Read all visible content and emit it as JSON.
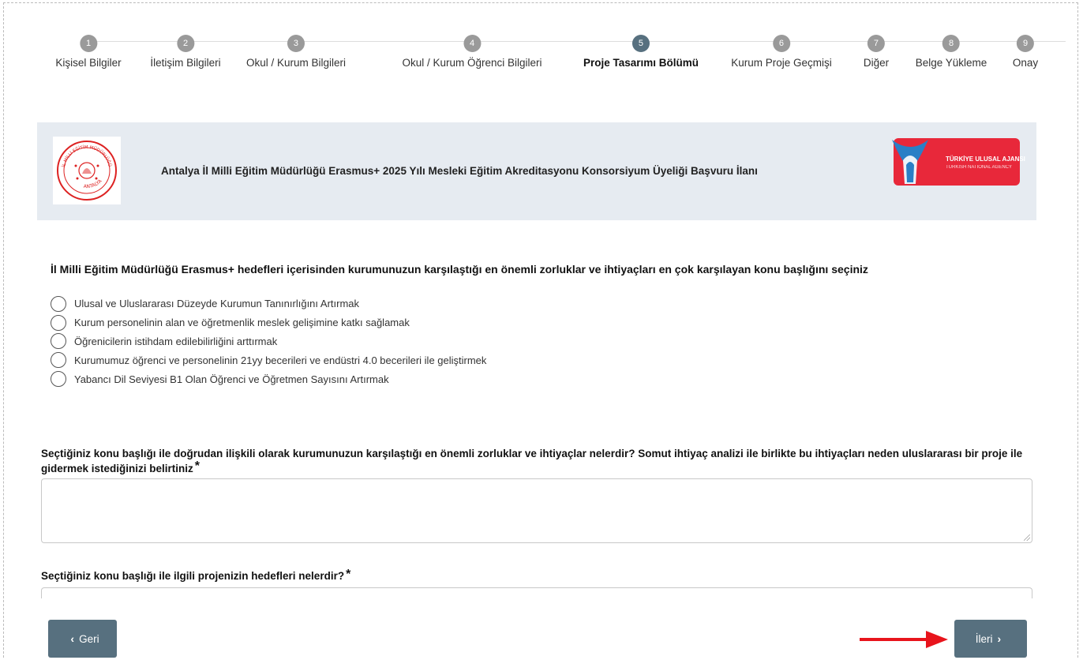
{
  "steps": [
    {
      "num": "1",
      "label": "Kişisel Bilgiler"
    },
    {
      "num": "2",
      "label": "İletişim Bilgileri"
    },
    {
      "num": "3",
      "label": "Okul / Kurum Bilgileri"
    },
    {
      "num": "4",
      "label": "Okul / Kurum Öğrenci Bilgileri"
    },
    {
      "num": "5",
      "label": "Proje Tasarımı Bölümü"
    },
    {
      "num": "6",
      "label": "Kurum Proje Geçmişi"
    },
    {
      "num": "7",
      "label": "Diğer"
    },
    {
      "num": "8",
      "label": "Belge Yükleme"
    },
    {
      "num": "9",
      "label": "Onay"
    }
  ],
  "active_step": "5",
  "banner": {
    "title": "Antalya İl Milli Eğitim Müdürlüğü Erasmus+ 2025 Yılı Mesleki Eğitim Akreditasyonu Konsorsiyum Üyeliği Başvuru İlanı",
    "seal_top_text": "İL MİLLİ EĞİTİM MÜDÜRLÜĞÜ",
    "seal_bottom_text": "ANTALYA",
    "agency_tr": "TÜRKİYE ULUSAL AJANSI",
    "agency_en": "TURKISH NATIONAL AGENCY"
  },
  "question1": {
    "text": "İl Milli Eğitim Müdürlüğü Erasmus+ hedefleri içerisinden kurumunuzun karşılaştığı en önemli zorluklar ve ihtiyaçları en çok karşılayan konu başlığını seçiniz",
    "options": [
      "Ulusal ve Uluslararası Düzeyde Kurumun Tanınırlığını Artırmak",
      "Kurum personelinin alan ve öğretmenlik meslek gelişimine katkı sağlamak",
      "Öğrenicilerin istihdam edilebilirliğini arttırmak",
      "Kurumumuz öğrenci ve personelinin 21yy becerileri ve endüstri 4.0 becerileri ile geliştirmek",
      "Yabancı Dil Seviyesi B1 Olan Öğrenci ve Öğretmen Sayısını Artırmak"
    ]
  },
  "question2": {
    "text": "Seçtiğiniz konu başlığı ile doğrudan ilişkili olarak kurumunuzun karşılaştığı en önemli zorluklar ve ihtiyaçlar nelerdir? Somut ihtiyaç analizi ile birlikte bu ihtiyaçları neden uluslararası bir proje ile gidermek istediğinizi belirtiniz",
    "required_mark": "*",
    "value": ""
  },
  "question3": {
    "text": "Seçtiğiniz konu başlığı ile ilgili projenizin hedefleri nelerdir?",
    "required_mark": "*",
    "value": ""
  },
  "buttons": {
    "back_label": "Geri",
    "next_label": "İleri",
    "back_icon": "chevron-left-icon",
    "next_icon": "chevron-right-icon"
  },
  "colors": {
    "primary": "#57707f",
    "step_inactive": "#9a9a9a",
    "banner_bg": "#e6ebf1",
    "agency_red": "#e8283a",
    "arrow_red": "#e8141c"
  }
}
